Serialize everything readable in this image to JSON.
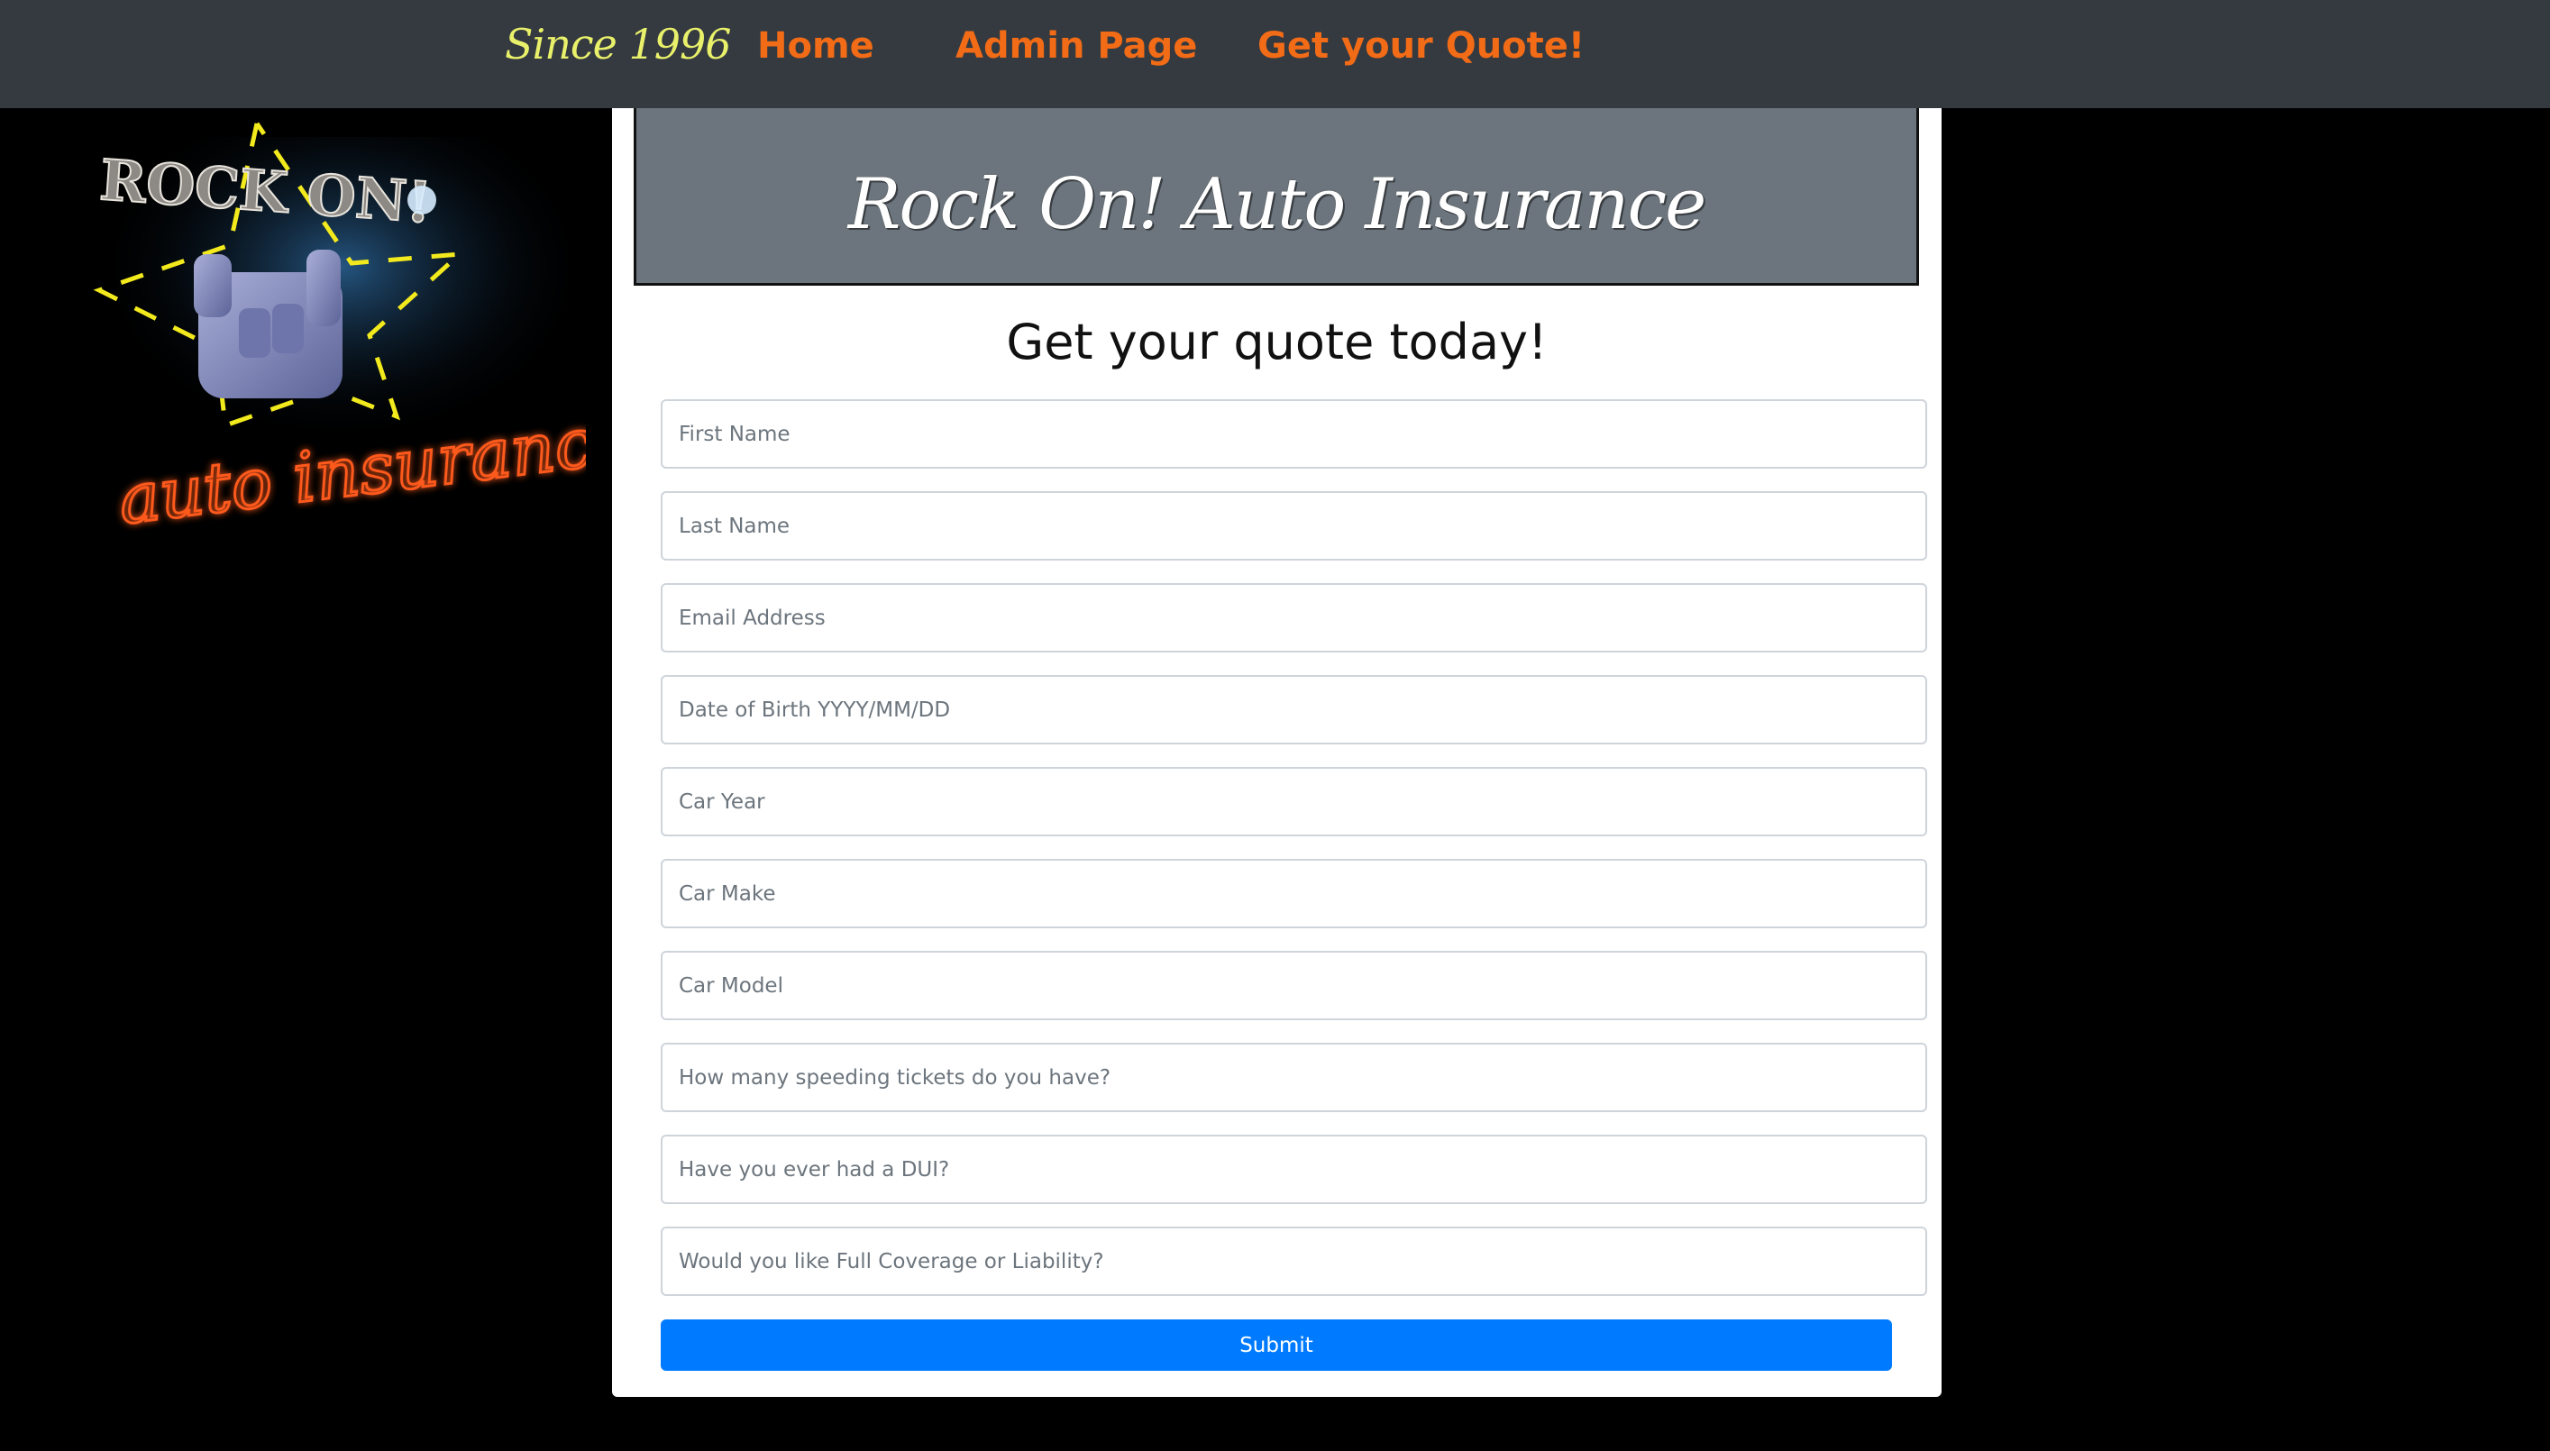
{
  "nav": {
    "brand": "Since 1996",
    "links": [
      "Home",
      "Admin Page",
      "Get your Quote!"
    ]
  },
  "logo": {
    "top_text": "ROCK ON!",
    "bottom_text": "auto insurance"
  },
  "banner": {
    "title": "Rock On! Auto Insurance"
  },
  "form": {
    "heading": "Get your quote today!",
    "fields": [
      {
        "placeholder": "First Name",
        "value": ""
      },
      {
        "placeholder": "Last Name",
        "value": ""
      },
      {
        "placeholder": "Email Address",
        "value": ""
      },
      {
        "placeholder": "Date of Birth YYYY/MM/DD",
        "value": ""
      },
      {
        "placeholder": "Car Year",
        "value": ""
      },
      {
        "placeholder": "Car Make",
        "value": ""
      },
      {
        "placeholder": "Car Model",
        "value": ""
      },
      {
        "placeholder": "How many speeding tickets do you have?",
        "value": ""
      },
      {
        "placeholder": "Have you ever had a DUI?",
        "value": ""
      },
      {
        "placeholder": "Would you like Full Coverage or Liability?",
        "value": ""
      }
    ],
    "submit_label": "Submit"
  },
  "colors": {
    "navbar_bg": "#343a40",
    "nav_link": "#f26b16",
    "brand": "#e9f06a",
    "banner_bg": "#6c757d",
    "submit_bg": "#007bff"
  }
}
